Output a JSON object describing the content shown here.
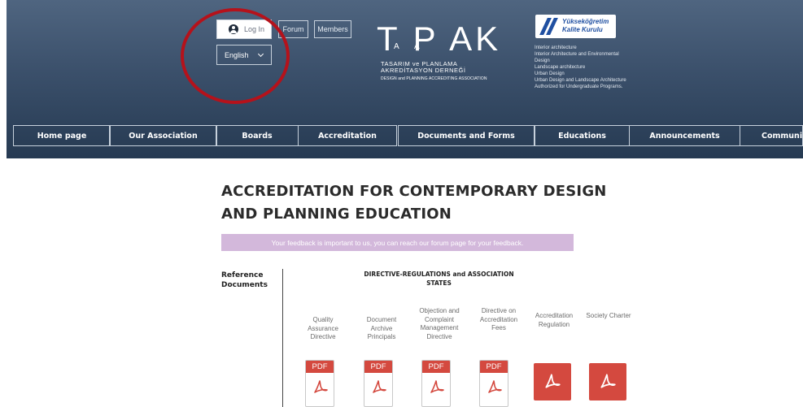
{
  "header": {
    "login_label": "Log In",
    "forum_label": "Forum",
    "members_label": "Members",
    "language": "English",
    "logo": {
      "big": "T P AK",
      "small_a1": "A",
      "small_a2": "A",
      "line1": "TASARIM ve PLANLAMA",
      "line2": "AKREDİTASYON DERNEĞİ",
      "line3": "DESIGN and PLANNING ACCREDITING ASSOCIATION"
    },
    "yok": {
      "line1": "Yükseköğretim",
      "line2": "Kalite Kurulu"
    },
    "authorized_programs": [
      "Interior architecture",
      "Interior Architecture and Environmental",
      "Design",
      "Landscape architecture",
      "Urban Design",
      "Urban Design and Landscape Architecture",
      "Authorized for Undergraduate Programs."
    ]
  },
  "nav": {
    "items": [
      "Home page",
      "Our Association",
      "Boards",
      "Accreditation",
      "Documents and Forms",
      "Educations",
      "Announcements",
      "Communic"
    ]
  },
  "main": {
    "title": "ACCREDITATION FOR CONTEMPORARY DESIGN AND PLANNING EDUCATION",
    "feedback": "Your feedback is important to us, you can reach our forum page for your feedback.",
    "reference_label": "Reference Documents",
    "directive_title": "DIRECTIVE-REGULATIONS and ASSOCIATION STATES",
    "documents": [
      {
        "label": "Quality Assurance Directive",
        "icon": "pdf-file-icon",
        "badge": "PDF"
      },
      {
        "label": "Document Archive Principals",
        "icon": "pdf-file-icon",
        "badge": "PDF"
      },
      {
        "label": "Objection and Complaint Management Directive",
        "icon": "pdf-file-icon",
        "badge": "PDF"
      },
      {
        "label": "Directive on Accreditation Fees",
        "icon": "pdf-file-icon",
        "badge": "PDF"
      },
      {
        "label": "Accreditation Regulation",
        "icon": "acrobat-icon"
      },
      {
        "label": "Society Charter",
        "icon": "acrobat-icon"
      }
    ]
  },
  "colors": {
    "header_top": "#4f6580",
    "header_bottom": "#263a52",
    "pdf_red": "#d4493f",
    "feedback_bg": "#d3b8db",
    "annotation_circle": "#b5121b"
  }
}
